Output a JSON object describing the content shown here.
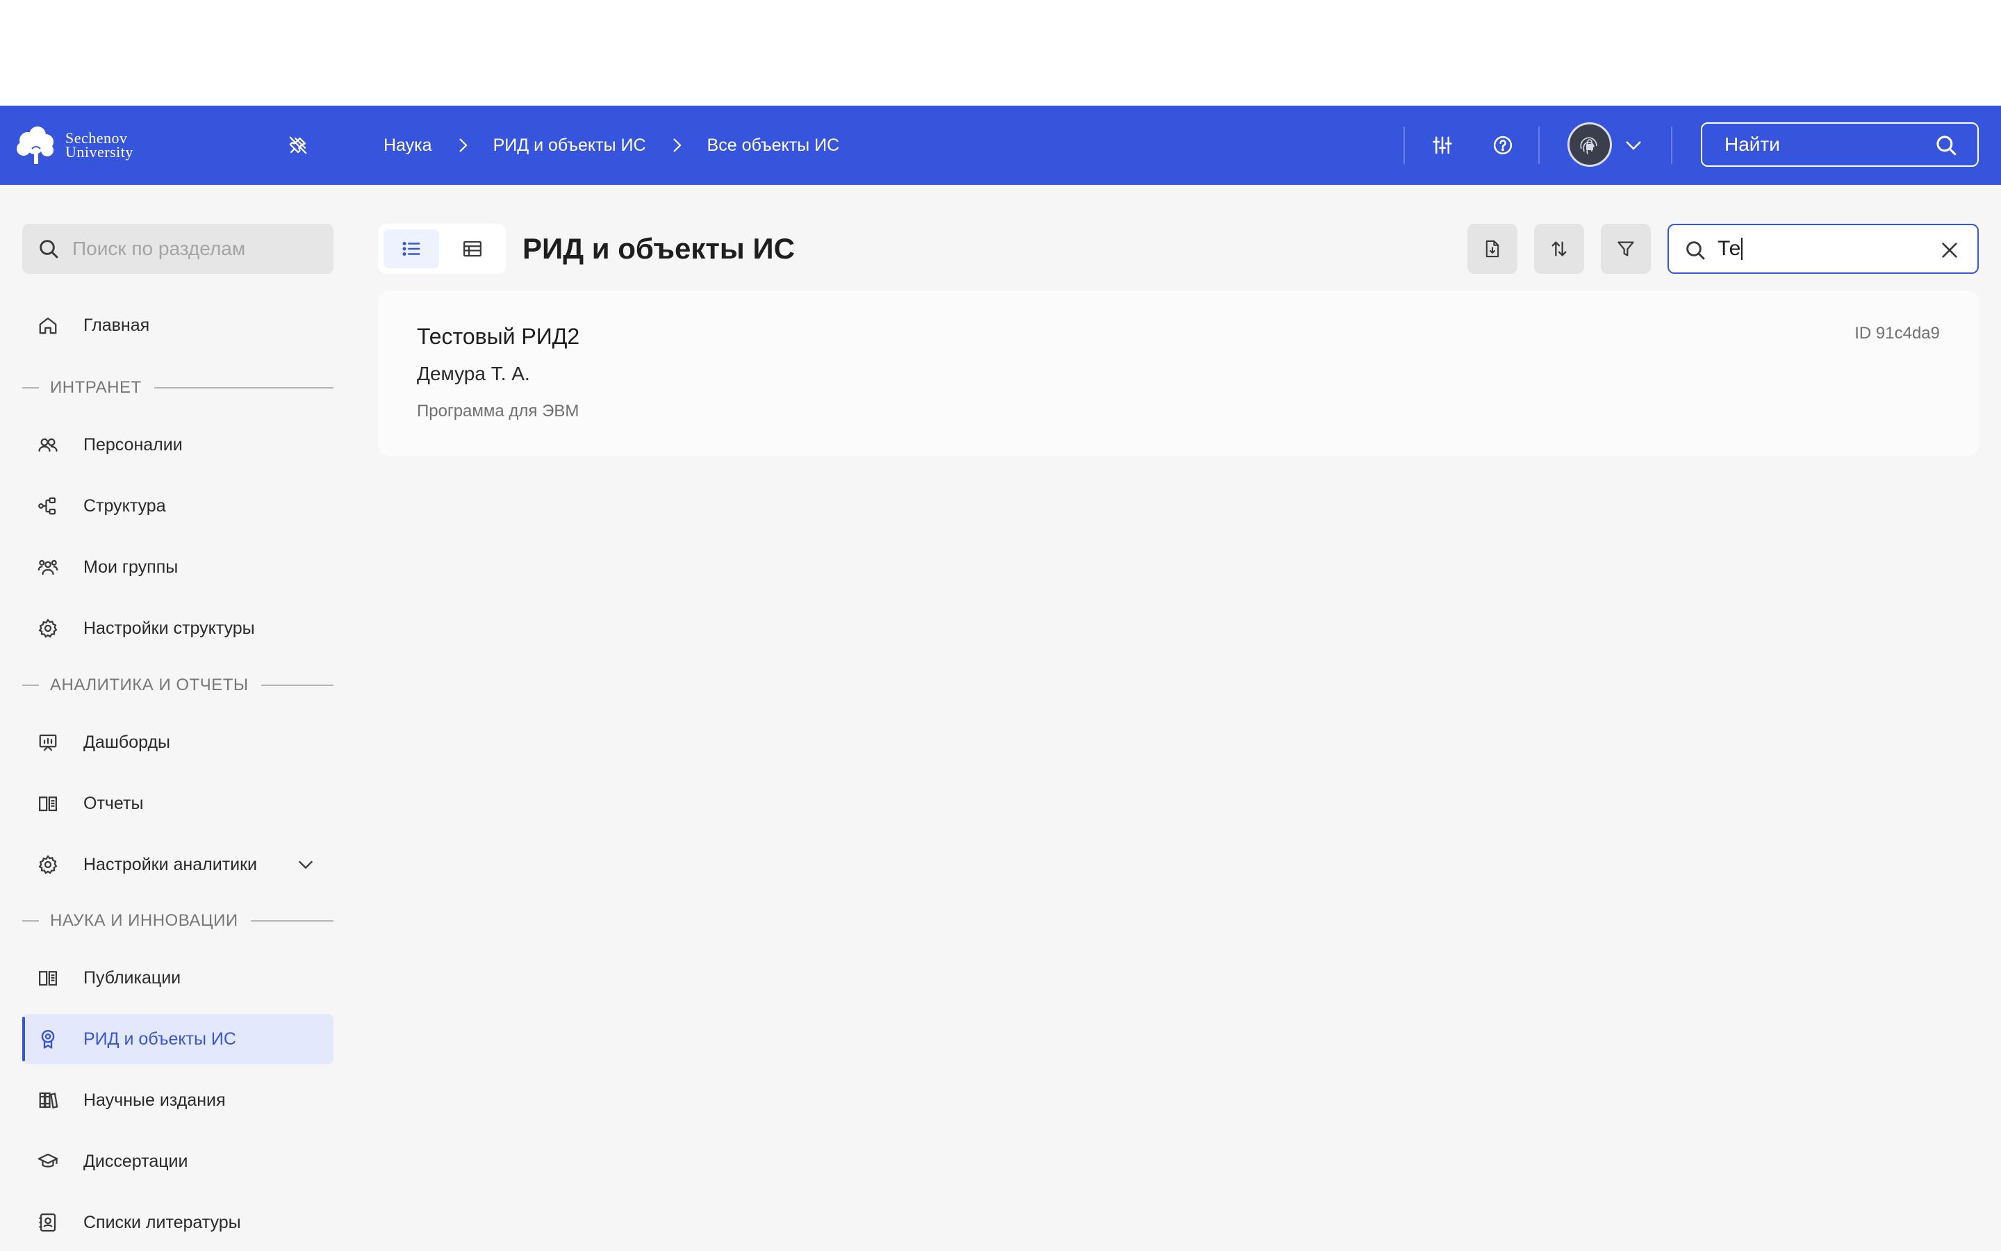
{
  "header": {
    "logo_line1": "Sechenov",
    "logo_line2": "University",
    "breadcrumbs": [
      "Наука",
      "РИД и объекты ИС",
      "Все объекты ИС"
    ],
    "search_label": "Найти"
  },
  "sidebar": {
    "search_placeholder": "Поиск по разделам",
    "items": {
      "home": "Главная",
      "persons": "Персоналии",
      "structure": "Структура",
      "groups": "Мои группы",
      "structure_settings": "Настройки структуры",
      "dashboards": "Дашборды",
      "reports": "Отчеты",
      "analytics_settings": "Настройки аналитики",
      "publications": "Публикации",
      "rid": "РИД и объекты ИС",
      "journals": "Научные издания",
      "dissertations": "Диссертации",
      "bibliography": "Списки литературы"
    },
    "sections": {
      "intranet": "ИНТРАНЕТ",
      "analytics": "АНАЛИТИКА И ОТЧЕТЫ",
      "science": "НАУКА И ИННОВАЦИИ"
    },
    "active_item": "rid"
  },
  "main": {
    "title": "РИД и объекты ИС",
    "search_value": "Те",
    "records": [
      {
        "title": "Тестовый РИД2",
        "author": "Демура Т. А.",
        "type": "Программа для ЭВМ",
        "id": "ID 91c4da9"
      }
    ]
  },
  "colors": {
    "brand": "#3655dc",
    "active_bg": "#e3e8fd",
    "page_bg": "#f6f6f6"
  }
}
